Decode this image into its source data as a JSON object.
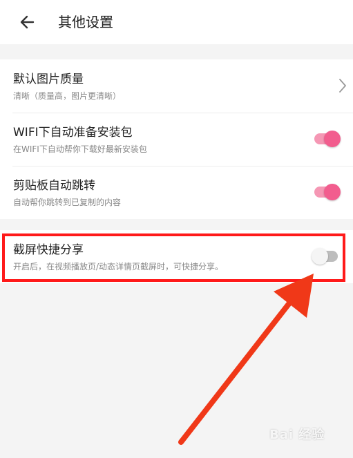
{
  "header": {
    "back_icon": "arrow-left-icon",
    "title": "其他设置"
  },
  "settings": [
    {
      "title": "默认图片质量",
      "subtitle": "清晰（质量高，图片更清晰）",
      "control": "chevron-right-icon"
    },
    {
      "title": "WIFI下自动准备安装包",
      "subtitle": "在WIFI下自动帮你下载好最新安装包",
      "control": "toggle",
      "enabled": true
    },
    {
      "title": "剪贴板自动跳转",
      "subtitle": "自动帮你跳转到已复制的内容",
      "control": "toggle",
      "enabled": true
    },
    {
      "title": "截屏快捷分享",
      "subtitle": "开启后，在视频播放页/动态详情页截屏时，可快捷分享。",
      "control": "toggle",
      "enabled": false
    }
  ],
  "colors": {
    "toggle_on": "#f25d8e",
    "toggle_on_track": "#f597b4",
    "toggle_off_track": "#bdbdbd",
    "highlight": "#ff1a1a",
    "background": "#f4f4f4"
  },
  "watermark": "Bai 经验"
}
